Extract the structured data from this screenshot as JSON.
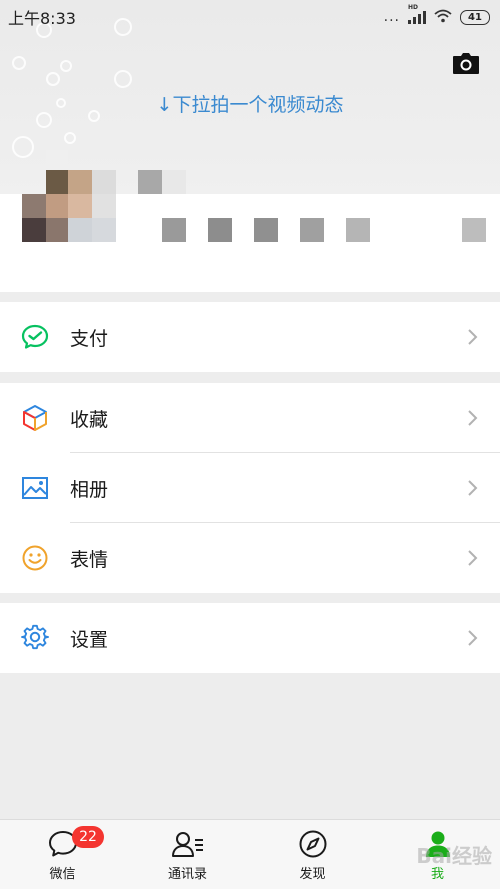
{
  "status_bar": {
    "time": "上午8:33",
    "dots": "...",
    "network": "HD",
    "battery": "41"
  },
  "header": {
    "pull_hint": "↓下拉拍一个视频动态",
    "camera_icon": "camera-icon"
  },
  "menu": {
    "pay": {
      "label": "支付",
      "icon": "wechat-pay-icon",
      "color": "#07c160"
    },
    "favorites": {
      "label": "收藏",
      "icon": "cube-icon"
    },
    "album": {
      "label": "相册",
      "icon": "picture-icon",
      "color": "#2e86de"
    },
    "stickers": {
      "label": "表情",
      "icon": "smiley-icon",
      "color": "#f0a32c"
    },
    "settings": {
      "label": "设置",
      "icon": "gear-icon",
      "color": "#2e86de"
    }
  },
  "tabbar": {
    "tabs": [
      {
        "label": "微信",
        "icon": "chat-bubble-icon",
        "badge": "22"
      },
      {
        "label": "通讯录",
        "icon": "contacts-icon"
      },
      {
        "label": "发现",
        "icon": "compass-icon"
      },
      {
        "label": "我",
        "icon": "person-icon",
        "active": true
      }
    ],
    "active_color": "#1aad19"
  },
  "watermark": "Bai经验"
}
